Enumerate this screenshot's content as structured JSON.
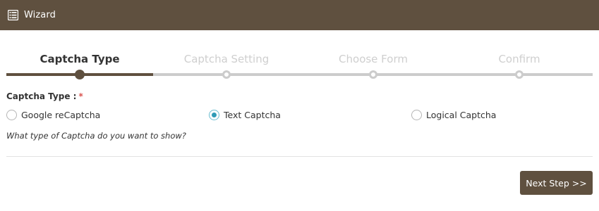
{
  "header": {
    "title": "Wizard",
    "icon": "list-icon"
  },
  "steps": [
    {
      "label": "Captcha Type",
      "state": "active"
    },
    {
      "label": "Captcha Setting",
      "state": "pending"
    },
    {
      "label": "Choose Form",
      "state": "pending"
    },
    {
      "label": "Confirm",
      "state": "pending"
    }
  ],
  "form": {
    "label": "Captcha Type :",
    "required_mark": "*",
    "options": [
      {
        "label": "Google reCaptcha",
        "checked": false
      },
      {
        "label": "Text Captcha",
        "checked": true
      },
      {
        "label": "Logical Captcha",
        "checked": false
      }
    ],
    "hint": "What type of Captcha do you want to show?"
  },
  "footer": {
    "next_label": "Next Step >>"
  },
  "colors": {
    "brand": "#5f503f",
    "radio_accent": "#2e9bb6",
    "inactive": "#cccccc"
  }
}
